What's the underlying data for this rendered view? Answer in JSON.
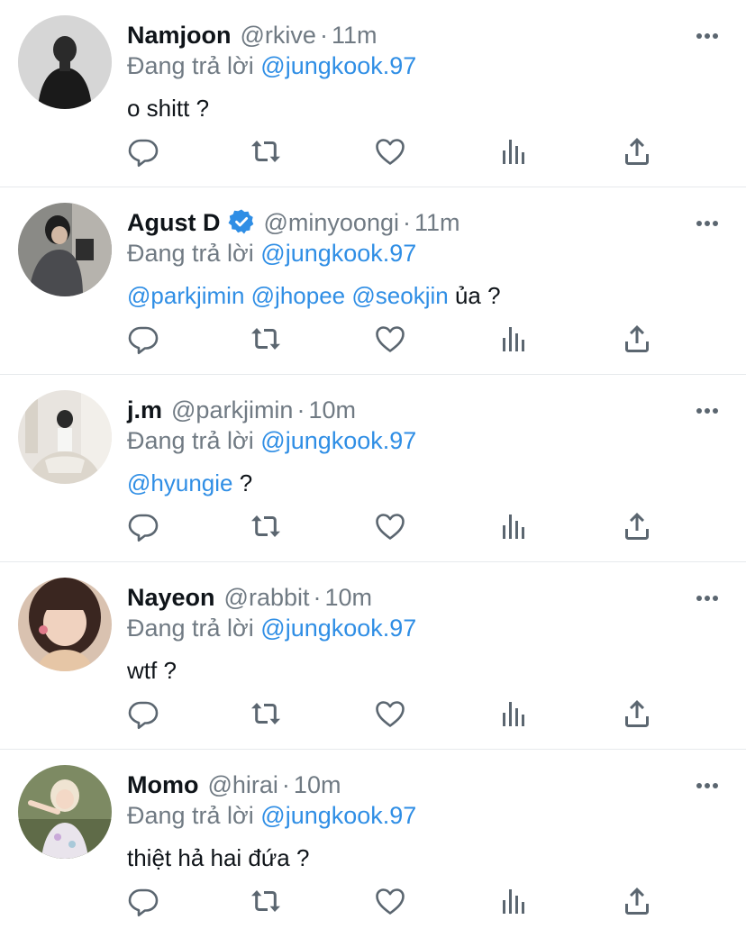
{
  "colors": {
    "accent": "#2f8ee5",
    "secondary_text": "#707a83",
    "primary_text": "#0f1419",
    "divider": "#e6e9ec",
    "icon": "#5b6670"
  },
  "icons": [
    "reply-icon",
    "retweet-icon",
    "like-icon",
    "analytics-icon",
    "share-icon",
    "more-icon",
    "verified-badge-icon"
  ],
  "tweets": [
    {
      "name": "Namjoon",
      "handle": "@rkive",
      "dot": "·",
      "time": "11m",
      "reply_prefix": "Đang trả lời",
      "reply_to": "@jungkook.97",
      "body": "o shitt ?",
      "mentions": []
    },
    {
      "name": "Agust D",
      "verified": true,
      "handle": "@minyoongi",
      "dot": "·",
      "time": "11m",
      "reply_prefix": "Đang trả lời",
      "reply_to": "@jungkook.97",
      "body": "ủa ?",
      "mentions": [
        "@parkjimin",
        "@jhopee",
        "@seokjin"
      ]
    },
    {
      "name": "j.m",
      "handle": "@parkjimin",
      "dot": "·",
      "time": "10m",
      "reply_prefix": "Đang trả lời",
      "reply_to": "@jungkook.97",
      "body": "?",
      "mentions": [
        "@hyungie"
      ]
    },
    {
      "name": "Nayeon",
      "handle": "@rabbit",
      "dot": "·",
      "time": "10m",
      "reply_prefix": "Đang trả lời",
      "reply_to": "@jungkook.97",
      "body": "wtf ?",
      "mentions": []
    },
    {
      "name": "Momo",
      "handle": "@hirai",
      "dot": "·",
      "time": "10m",
      "reply_prefix": "Đang trả lời",
      "reply_to": "@jungkook.97",
      "body": "thiệt hả hai đứa ?",
      "mentions": []
    }
  ]
}
